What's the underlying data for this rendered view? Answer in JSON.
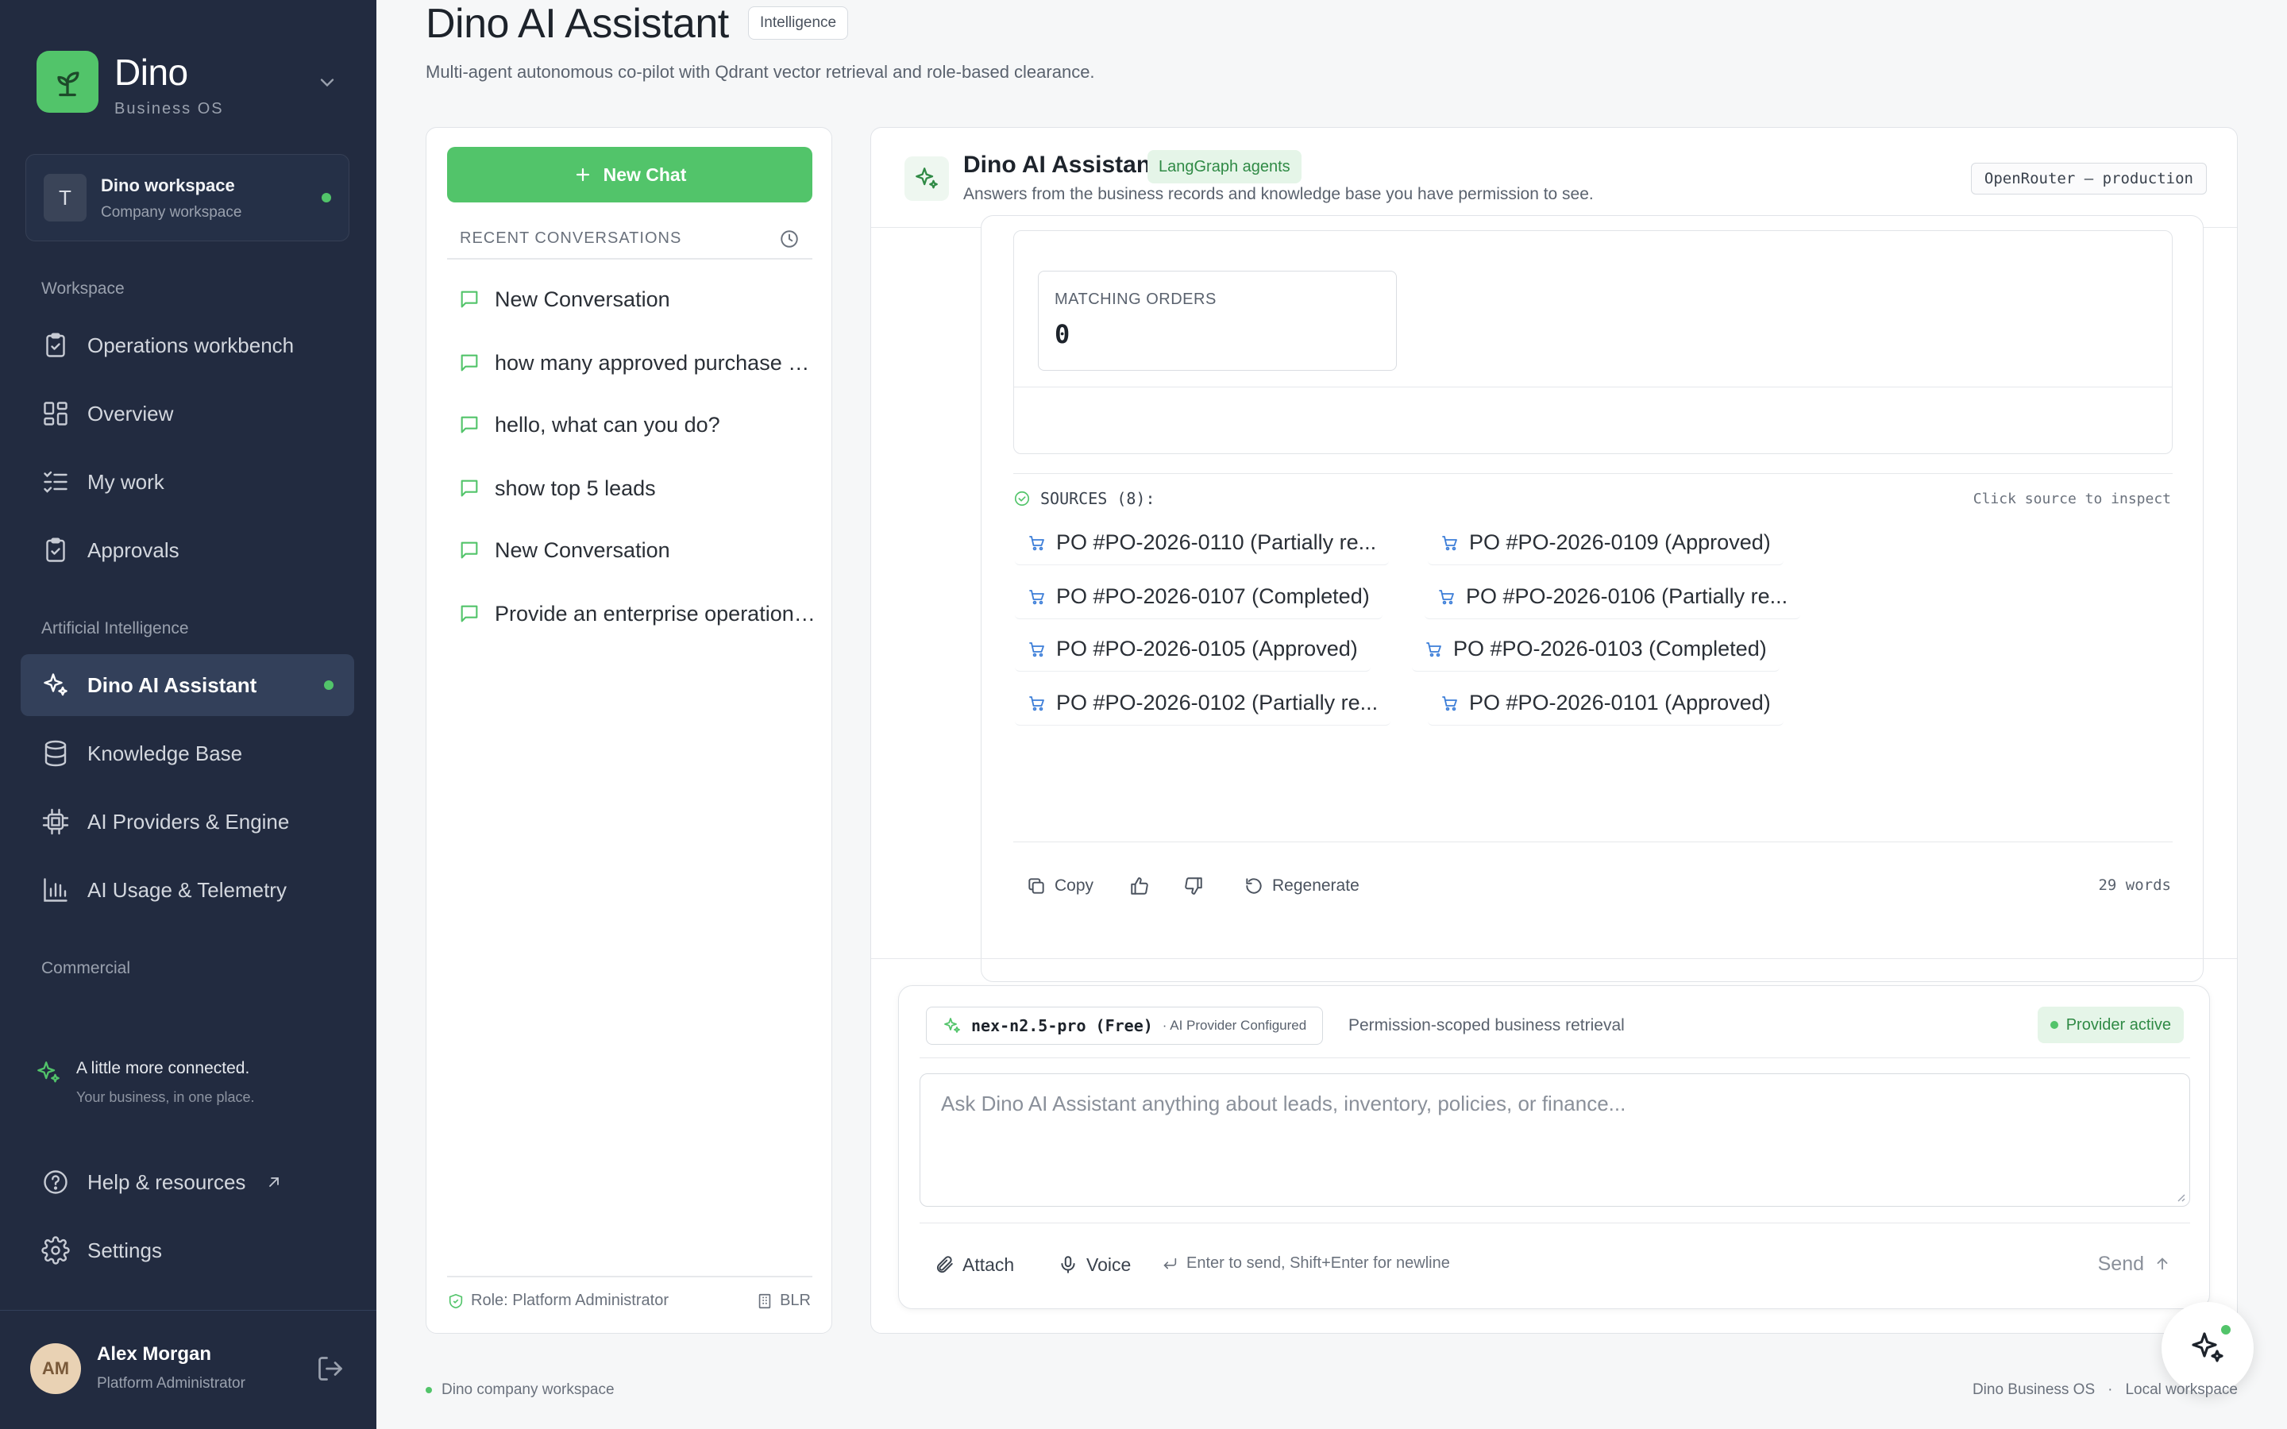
{
  "sidebar": {
    "brand": {
      "name": "Dino",
      "subtitle": "Business OS"
    },
    "workspace": {
      "initial": "T",
      "name": "Dino workspace",
      "type": "Company workspace"
    },
    "sections": {
      "workspace": "Workspace",
      "ai": "Artificial Intelligence",
      "commercial": "Commercial"
    },
    "items": [
      {
        "label": "Operations workbench",
        "icon": "clipboard-icon"
      },
      {
        "label": "Overview",
        "icon": "grid-icon"
      },
      {
        "label": "My work",
        "icon": "list-check-icon"
      },
      {
        "label": "Approvals",
        "icon": "clipboard-check-icon"
      },
      {
        "label": "Dino AI Assistant",
        "icon": "sparkles-icon",
        "active": true
      },
      {
        "label": "Knowledge Base",
        "icon": "database-icon"
      },
      {
        "label": "AI Providers & Engine",
        "icon": "cpu-icon"
      },
      {
        "label": "AI Usage & Telemetry",
        "icon": "bar-chart-icon"
      }
    ],
    "promo": {
      "title": "A little more connected.",
      "subtitle": "Your business, in one place."
    },
    "help": "Help & resources",
    "settings": "Settings",
    "user": {
      "initials": "AM",
      "name": "Alex Morgan",
      "role": "Platform Administrator"
    }
  },
  "header": {
    "title": "Dino AI Assistant",
    "badge": "Intelligence",
    "subtitle": "Multi-agent autonomous co-pilot with Qdrant vector retrieval and role-based clearance."
  },
  "conversations": {
    "new_chat": "New Chat",
    "recent_label": "RECENT CONVERSATIONS",
    "items": [
      "New Conversation",
      "how many approved purchase orders",
      "hello, what can you do?",
      "show top 5 leads",
      "New Conversation",
      "Provide an enterprise operations summary"
    ],
    "role": "Role: Platform Administrator",
    "location": "BLR"
  },
  "chat": {
    "title": "Dino AI Assistant",
    "tag": "LangGraph agents",
    "description": "Answers from the business records and knowledge base you have permission to see.",
    "provider": "OpenRouter — production",
    "metric": {
      "label": "MATCHING ORDERS",
      "value": "0"
    },
    "sources_label": "SOURCES (8):",
    "sources_hint": "Click source to inspect",
    "sources": [
      "PO #PO-2026-0110 (Partially re...",
      "PO #PO-2026-0109 (Approved)",
      "PO #PO-2026-0107 (Completed)",
      "PO #PO-2026-0106 (Partially re...",
      "PO #PO-2026-0105 (Approved)",
      "PO #PO-2026-0103 (Completed)",
      "PO #PO-2026-0102 (Partially re...",
      "PO #PO-2026-0101 (Approved)"
    ],
    "actions": {
      "copy": "Copy",
      "regenerate": "Regenerate",
      "word_count": "29 words"
    },
    "composer": {
      "model": "nex-n2.5-pro (Free)",
      "model_status": "· AI Provider Configured",
      "retrieval": "Permission-scoped business retrieval",
      "provider_status": "Provider active",
      "placeholder": "Ask Dino AI Assistant anything about leads, inventory, policies, or finance...",
      "attach": "Attach",
      "voice": "Voice",
      "enter_hint": "Enter to send, Shift+Enter for newline",
      "send": "Send"
    }
  },
  "footer": {
    "left": "Dino company workspace",
    "right_1": "Dino Business OS",
    "separator": "·",
    "right_2": "Local workspace"
  },
  "colors": {
    "sidebar_bg": "#222b40",
    "accent": "#52c46a",
    "active_item": "#33405a"
  }
}
